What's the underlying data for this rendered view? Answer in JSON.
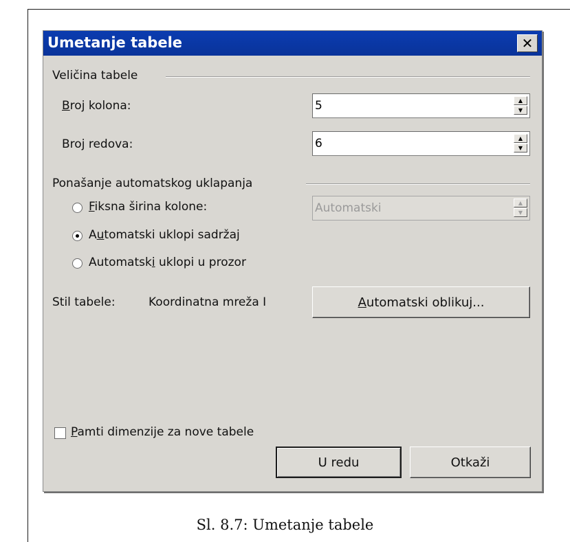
{
  "dialog": {
    "title": "Umetanje tabele",
    "close_symbol": "✕",
    "size_group": {
      "label": "Veličina tabele",
      "columns": {
        "label_pre": "",
        "label_mnemonic": "B",
        "label_post": "roj kolona:",
        "value": "5"
      },
      "rows": {
        "label_pre": "Bro",
        "label_mnemonic": "j",
        "label_post": " redova:",
        "value": "6"
      }
    },
    "autofit_group": {
      "label": "Ponašanje automatskog uklapanja",
      "fixed": {
        "label_pre": "",
        "label_mnemonic": "F",
        "label_post": "iksna širina kolone:",
        "selected": false,
        "value": "Automatski"
      },
      "contents": {
        "label_pre": "A",
        "label_mnemonic": "u",
        "label_post": "tomatski uklopi sadržaj",
        "selected": true
      },
      "window": {
        "label_pre": "Automatsk",
        "label_mnemonic": "i",
        "label_post": " uklopi u prozor",
        "selected": false
      }
    },
    "style": {
      "label": "Stil tabele:",
      "value": "Koordinatna mreža I",
      "autoformat_pre": "",
      "autoformat_mnemonic": "A",
      "autoformat_post": "utomatski oblikuj..."
    },
    "remember": {
      "label_pre": "",
      "label_mnemonic": "P",
      "label_post": "amti dimenzije za nove tabele",
      "checked": false
    },
    "ok_label": "U redu",
    "cancel_label": "Otkaži"
  },
  "caption": "Sl. 8.7: Umetanje tabele",
  "colors": {
    "titlebar": "#0b3cb0",
    "dialog_bg": "#d9d7d2"
  }
}
